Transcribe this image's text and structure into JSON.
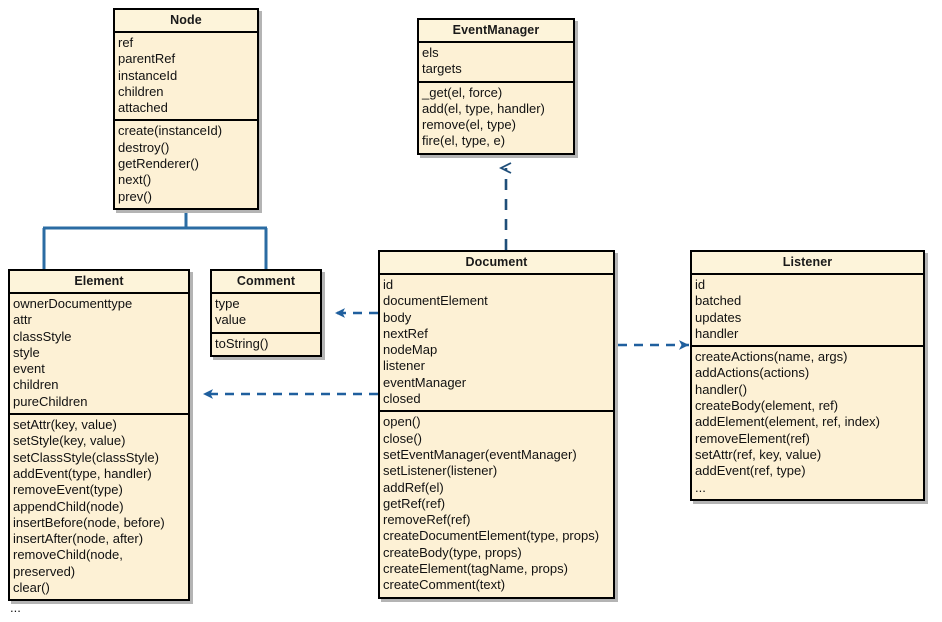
{
  "diagram": {
    "type": "uml-class-diagram",
    "background": "#ffffff",
    "box_fill": "#fdf1d5",
    "box_header_fill": "#fdf4da",
    "box_border": "#000000",
    "shadow": "#b4b4b4",
    "relation_color": "#2b6ca3",
    "ellipsis": "..."
  },
  "classes": {
    "node": {
      "name": "Node",
      "attributes": [
        "ref",
        "parentRef",
        "instanceId",
        "children",
        "attached"
      ],
      "methods": [
        "create(instanceId)",
        "destroy()",
        "getRenderer()",
        "next()",
        "prev()"
      ]
    },
    "eventmanager": {
      "name": "EventManager",
      "attributes": [
        "els",
        "targets"
      ],
      "methods": [
        "_get(el, force)",
        "add(el, type, handler)",
        "remove(el, type)",
        "fire(el, type, e)"
      ]
    },
    "element": {
      "name": "Element",
      "attributes": [
        "ownerDocumenttype",
        "attr",
        "classStyle",
        "style",
        "event",
        "children",
        "pureChildren"
      ],
      "methods": [
        "setAttr(key, value)",
        "setStyle(key, value)",
        "setClassStyle(classStyle)",
        "addEvent(type, handler)",
        "removeEvent(type)",
        "appendChild(node)",
        "insertBefore(node, before)",
        "insertAfter(node, after)",
        "removeChild(node, preserved)",
        "clear()"
      ],
      "trailing_ellipsis": "..."
    },
    "comment": {
      "name": "Comment",
      "attributes": [
        "type",
        "value"
      ],
      "methods": [
        "toString()"
      ]
    },
    "document": {
      "name": "Document",
      "attributes": [
        "id",
        "documentElement",
        "body",
        "nextRef",
        "nodeMap",
        "listener",
        "eventManager",
        "closed"
      ],
      "methods": [
        "open()",
        "close()",
        "setEventManager(eventManager)",
        "setListener(listener)",
        "addRef(el)",
        "getRef(ref)",
        "removeRef(ref)",
        "createDocumentElement(type, props)",
        "createBody(type, props)",
        "createElement(tagName, props)",
        "createComment(text)"
      ]
    },
    "listener": {
      "name": "Listener",
      "attributes": [
        "id",
        "batched",
        "updates",
        "handler"
      ],
      "methods": [
        "createActions(name, args)",
        "addActions(actions)",
        "handler()",
        "createBody(element, ref)",
        "addElement(element, ref, index)",
        "removeElement(ref)",
        "setAttr(ref, key, value)",
        "addEvent(ref, type)",
        "..."
      ]
    }
  },
  "relations": [
    {
      "id": "element-to-node",
      "from": "Element",
      "to": "Node",
      "style": "generalization",
      "line": "solid",
      "arrow": "filled-triangle"
    },
    {
      "id": "comment-to-node",
      "from": "Comment",
      "to": "Node",
      "style": "generalization",
      "line": "solid",
      "arrow": "filled-triangle"
    },
    {
      "id": "document-to-eventmanager",
      "from": "Document",
      "to": "EventManager",
      "style": "dependency",
      "line": "dashed",
      "arrow": "open-v"
    },
    {
      "id": "document-to-comment",
      "from": "Document",
      "to": "Comment",
      "style": "dependency",
      "line": "dashed",
      "arrow": "filled"
    },
    {
      "id": "document-to-element",
      "from": "Document",
      "to": "Element",
      "style": "dependency",
      "line": "dashed",
      "arrow": "filled"
    },
    {
      "id": "document-to-listener",
      "from": "Document",
      "to": "Listener",
      "style": "dependency",
      "line": "dashed",
      "arrow": "filled"
    }
  ]
}
